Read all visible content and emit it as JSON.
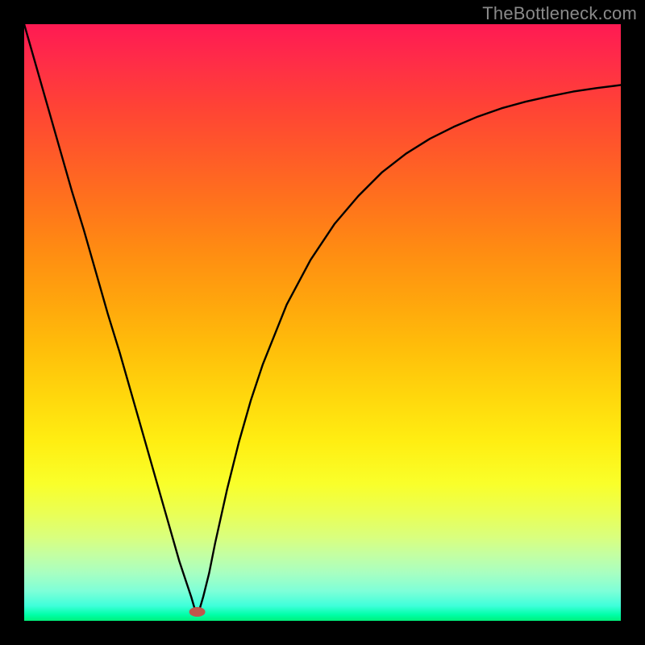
{
  "watermark": "TheBottleneck.com",
  "chart_data": {
    "type": "line",
    "title": "",
    "xlabel": "",
    "ylabel": "",
    "xlim": [
      0,
      100
    ],
    "ylim": [
      0,
      100
    ],
    "grid": false,
    "legend": false,
    "annotations": [
      {
        "name": "min-marker",
        "x": 29,
        "y": 1.5,
        "color": "#c0564b",
        "shape": "ellipse"
      }
    ],
    "series": [
      {
        "name": "bottleneck-curve",
        "color": "#000000",
        "x": [
          0,
          2,
          4,
          6,
          8,
          10,
          12,
          14,
          16,
          18,
          20,
          22,
          24,
          26,
          27,
          28,
          28.5,
          29,
          29.5,
          30,
          31,
          32,
          34,
          36,
          38,
          40,
          44,
          48,
          52,
          56,
          60,
          64,
          68,
          72,
          76,
          80,
          84,
          88,
          92,
          96,
          100
        ],
        "values": [
          100,
          93,
          86,
          79,
          72,
          65.5,
          58.5,
          51.5,
          45,
          38,
          31,
          24,
          17,
          10,
          7,
          4,
          2.3,
          1.2,
          2.3,
          4,
          8,
          13,
          22,
          30,
          37,
          43,
          53,
          60.5,
          66.5,
          71.2,
          75.2,
          78.3,
          80.8,
          82.8,
          84.5,
          85.9,
          87.0,
          87.9,
          88.7,
          89.3,
          89.8
        ]
      }
    ]
  }
}
